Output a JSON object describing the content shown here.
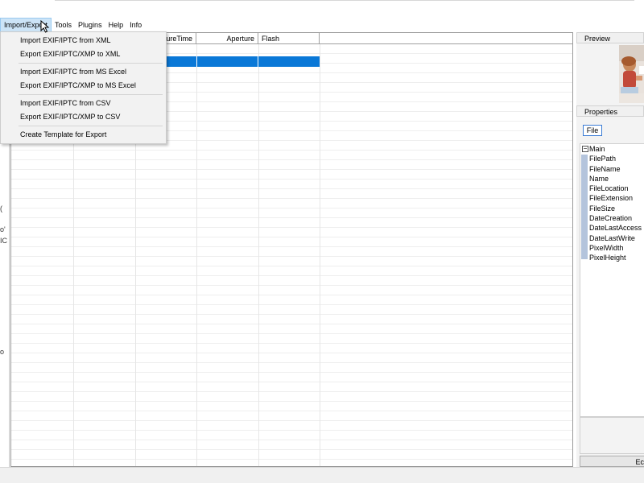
{
  "menubar": {
    "items": [
      "Import/Export",
      "Tools",
      "Plugins",
      "Help",
      "Info"
    ]
  },
  "import_menu": {
    "items": [
      "Import EXIF/IPTC from XML",
      "Export EXIF/IPTC/XMP to XML",
      "Import EXIF/IPTC from MS Excel",
      "Export EXIF/IPTC/XMP to MS Excel",
      "Import EXIF/IPTC from CSV",
      "Export EXIF/IPTC/XMP to CSV",
      "Create Template for Export"
    ]
  },
  "grid": {
    "columns": [
      "ureTime",
      "Aperture",
      "Flash"
    ],
    "selection_color": "#0a78d7"
  },
  "left_strip": {
    "glyphs": [
      "(",
      "o'",
      "IC",
      "o"
    ]
  },
  "right_panel": {
    "preview_title": "Preview",
    "properties_title": "Properties",
    "file_tab": "File",
    "properties": {
      "group": "Main",
      "expand": "−",
      "items": [
        "FilePath",
        "FileName",
        "Name",
        "FileLocation",
        "FileExtension",
        "FileSize",
        "DateCreation",
        "DateLastAccess",
        "DateLastWrite",
        "PixelWidth",
        "PixelHeight"
      ]
    },
    "bottom_button": "Ec"
  }
}
